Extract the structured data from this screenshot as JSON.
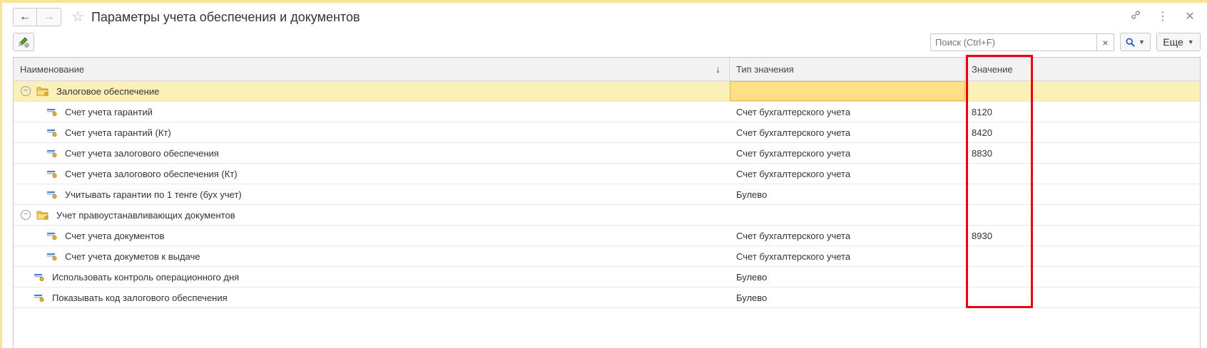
{
  "window": {
    "title": "Параметры учета обеспечения и документов"
  },
  "search": {
    "placeholder": "Поиск (Ctrl+F)"
  },
  "toolbar": {
    "more_label": "Еще"
  },
  "table": {
    "columns": [
      "Наименование",
      "Тип значения",
      "Значение"
    ],
    "rows": [
      {
        "level": 0,
        "kind": "group",
        "name": "Залоговое обеспечение",
        "type": "",
        "value": "",
        "selected": true
      },
      {
        "level": 1,
        "kind": "param",
        "name": "Счет учета гарантий",
        "type": "Счет бухгалтерского учета",
        "value": "8120"
      },
      {
        "level": 1,
        "kind": "param",
        "name": "Счет учета гарантий (Кт)",
        "type": "Счет бухгалтерского учета",
        "value": "8420"
      },
      {
        "level": 1,
        "kind": "param",
        "name": "Счет учета залогового обеспечения",
        "type": "Счет бухгалтерского учета",
        "value": "8830"
      },
      {
        "level": 1,
        "kind": "param",
        "name": "Счет учета залогового обеспечения (Кт)",
        "type": "Счет бухгалтерского учета",
        "value": ""
      },
      {
        "level": 1,
        "kind": "param",
        "name": "Учитывать гарантии по 1 тенге (бух учет)",
        "type": "Булево",
        "value": ""
      },
      {
        "level": 0,
        "kind": "group",
        "name": "Учет правоустанавливающих документов",
        "type": "",
        "value": ""
      },
      {
        "level": 1,
        "kind": "param",
        "name": "Счет учета документов",
        "type": "Счет бухгалтерского учета",
        "value": "8930"
      },
      {
        "level": 1,
        "kind": "param",
        "name": "Счет учета докуметов к выдаче",
        "type": "Счет бухгалтерского учета",
        "value": ""
      },
      {
        "level": 0,
        "kind": "param",
        "name": "Использовать контроль операционного дня",
        "type": "Булево",
        "value": ""
      },
      {
        "level": 0,
        "kind": "param",
        "name": "Показывать код залогового обеспечения",
        "type": "Булево",
        "value": ""
      }
    ]
  },
  "colors": {
    "selected_row": "#fcf0b9",
    "highlight_box": "#e8000f",
    "accent_top": "#f5e49a"
  }
}
